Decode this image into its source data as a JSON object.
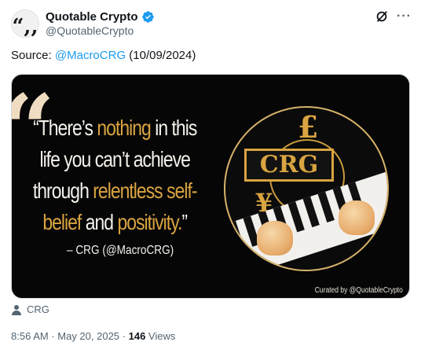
{
  "author": {
    "display_name": "Quotable Crypto",
    "handle": "@QuotableCrypto",
    "avatar_glyph": "“,,",
    "verified_color": "#1d9bf0"
  },
  "tweet": {
    "text_prefix": "Source: ",
    "mention": "@MacroCRG",
    "text_suffix": " (10/09/2024)"
  },
  "media": {
    "quote_line1_a": "“There’s ",
    "quote_line1_b": "nothing",
    "quote_line1_c": " in this",
    "quote_line2": "life you can’t achieve",
    "quote_line3_a": "through ",
    "quote_line3_b": "relentless self-",
    "quote_line4_a": "belief",
    "quote_line4_b": " and ",
    "quote_line4_c": "positivity.",
    "quote_line4_d": "”",
    "attribution": "– CRG  (@MacroCRG)",
    "logo_text": "CRG",
    "logo_pound": "£",
    "logo_yen": "¥",
    "curated": "Curated by @QuotableCrypto",
    "accent_gold": "#d9a441"
  },
  "community": {
    "icon": "person-icon",
    "label": "CRG"
  },
  "meta": {
    "time": "8:56 AM",
    "separator": " · ",
    "date": "May 20, 2025",
    "views_count": "146",
    "views_label": " Views"
  },
  "actions": {
    "grok_icon": "grok-icon",
    "more_label": "···"
  }
}
